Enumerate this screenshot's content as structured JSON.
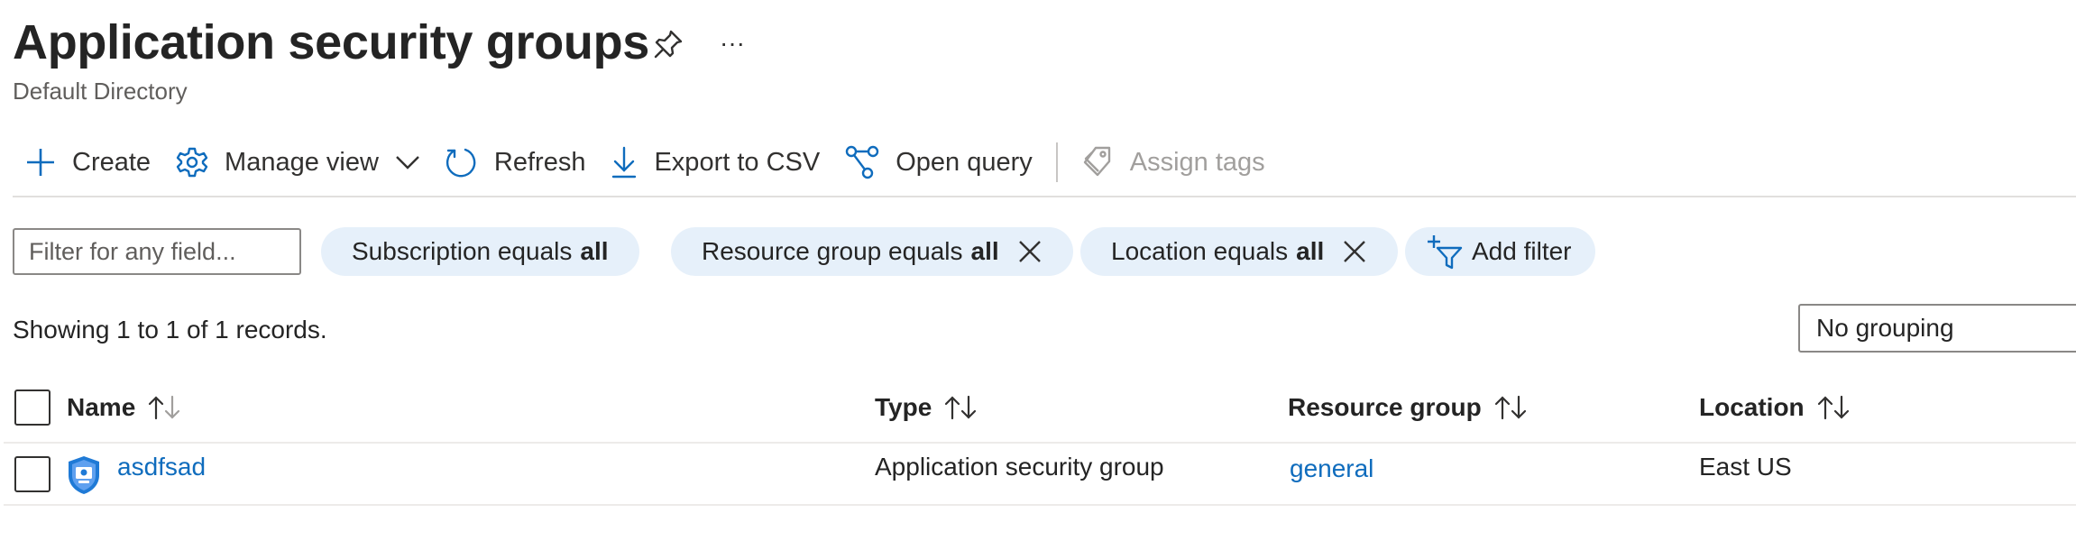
{
  "header": {
    "title": "Application security groups",
    "subtitle": "Default Directory",
    "more_glyph": "···"
  },
  "toolbar": {
    "create": "Create",
    "manage_view": "Manage view",
    "refresh": "Refresh",
    "export_csv": "Export to CSV",
    "open_query": "Open query",
    "assign_tags": "Assign tags"
  },
  "filters": {
    "placeholder": "Filter for any field...",
    "pills": [
      {
        "label": "Subscription equals",
        "value": "all"
      },
      {
        "label": "Resource group equals",
        "value": "all"
      },
      {
        "label": "Location equals",
        "value": "all"
      }
    ],
    "add_filter": "Add filter"
  },
  "summary": {
    "records_text": "Showing 1 to 1 of 1 records.",
    "grouping": "No grouping"
  },
  "table": {
    "columns": [
      "Name",
      "Type",
      "Resource group",
      "Location"
    ],
    "rows": [
      {
        "name": "asdfsad",
        "type": "Application security group",
        "resource_group": "general",
        "location": "East US"
      }
    ]
  },
  "icons": {
    "pin": "pin-icon",
    "create": "plus-icon",
    "manage_view": "gear-icon",
    "refresh": "refresh-icon",
    "export": "download-icon",
    "query": "query-icon",
    "tags": "tag-icon",
    "remove_filter": "close-icon",
    "add_filter": "add-filter-icon",
    "sort": "sort-icon",
    "row_resource": "application-security-group-icon"
  },
  "colors": {
    "accent": "#0f6cbd",
    "pill_bg": "#e6f0fa",
    "disabled_text": "#a19f9d"
  }
}
